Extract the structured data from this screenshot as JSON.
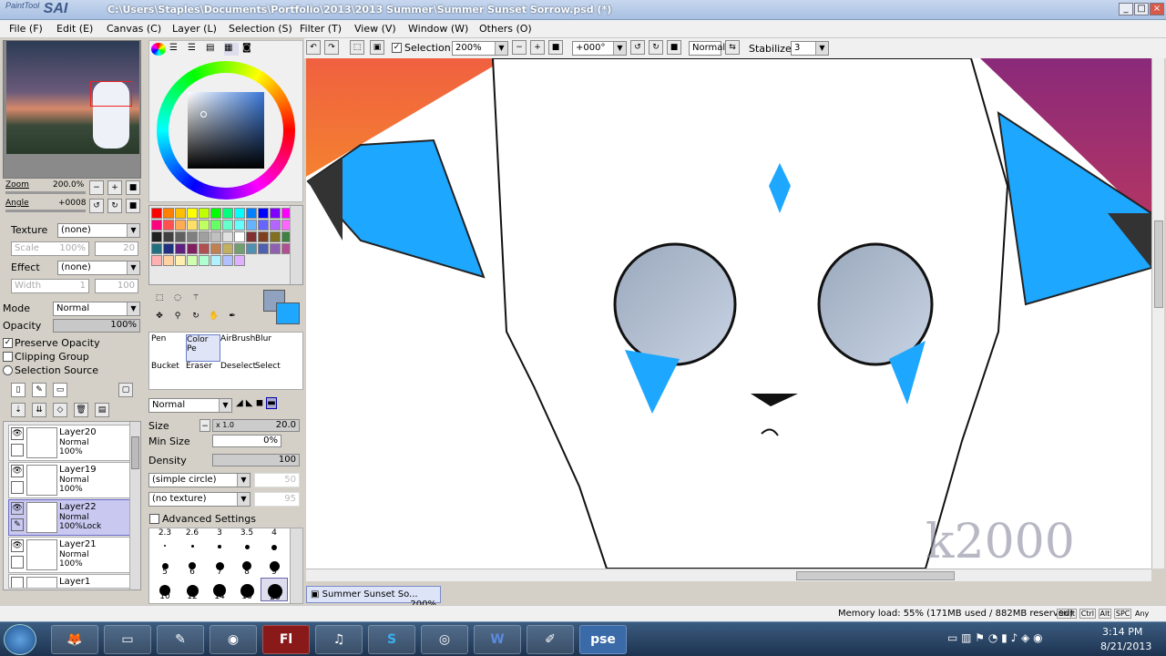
{
  "app": {
    "logo": "SAI",
    "logo_sub": "PaintTool",
    "title": "C:\\Users\\Staples\\Documents\\Portfolio\\2013\\2013 Summer\\Summer Sunset Sorrow.psd (*)"
  },
  "menu": [
    "File (F)",
    "Edit (E)",
    "Canvas (C)",
    "Layer (L)",
    "Selection (S)",
    "Filter (T)",
    "View (V)",
    "Window (W)",
    "Others (O)"
  ],
  "toolbar": {
    "selection_label": "Selection",
    "zoom": "200%",
    "angle": "+000°",
    "blend": "Normal",
    "stabilizer_label": "Stabilizer",
    "stabilizer": "3"
  },
  "navigator": {
    "zoom_label": "Zoom",
    "zoom_value": "200.0%",
    "angle_label": "Angle",
    "angle_value": "+0008"
  },
  "texture": {
    "label": "Texture",
    "value": "(none)",
    "scale_label": "Scale",
    "scale_value": "100%",
    "scale_num": "20"
  },
  "effect": {
    "label": "Effect",
    "value": "(none)",
    "width_label": "Width",
    "width_value": "1",
    "width_num": "100"
  },
  "layer_props": {
    "mode_label": "Mode",
    "mode": "Normal",
    "opacity_label": "Opacity",
    "opacity": "100%",
    "preserve": "Preserve Opacity",
    "clipping": "Clipping Group",
    "selsource": "Selection Source"
  },
  "layers": [
    {
      "name": "Layer20",
      "mode": "Normal",
      "opacity": "100%",
      "selected": false
    },
    {
      "name": "Layer19",
      "mode": "Normal",
      "opacity": "100%",
      "selected": false
    },
    {
      "name": "Layer22",
      "mode": "Normal",
      "opacity": "100%Lock",
      "selected": true
    },
    {
      "name": "Layer21",
      "mode": "Normal",
      "opacity": "100%",
      "selected": false
    },
    {
      "name": "Layer1",
      "mode": "",
      "opacity": "",
      "selected": false
    }
  ],
  "tools": [
    {
      "label": "Pen",
      "selected": false
    },
    {
      "label": "Color Pe",
      "selected": true
    },
    {
      "label": "AirBrush",
      "selected": false
    },
    {
      "label": "Blur",
      "selected": false
    },
    {
      "label": "Bucket",
      "selected": false
    },
    {
      "label": "Eraser",
      "selected": false
    },
    {
      "label": "Deselect",
      "selected": false
    },
    {
      "label": "Select",
      "selected": false
    }
  ],
  "brush": {
    "blend": "Normal",
    "size_label": "Size",
    "size_mult": "x 1.0",
    "size": "20.0",
    "minsize_label": "Min Size",
    "minsize": "0%",
    "density_label": "Density",
    "density": "100",
    "shape": "(simple circle)",
    "shape_num": "50",
    "texture": "(no texture)",
    "texture_num": "95",
    "advanced": "Advanced Settings"
  },
  "brush_sizes": [
    "2.3",
    "2.6",
    "3",
    "3.5",
    "4",
    "5",
    "6",
    "7",
    "8",
    "9",
    "10",
    "12",
    "14",
    "16",
    "20"
  ],
  "colors": {
    "primary": "#8fa3c0",
    "secondary": "#1ea7ff"
  },
  "palette": [
    "#ff0000",
    "#ff7f00",
    "#ffbf00",
    "#ffff00",
    "#bfff00",
    "#00ff00",
    "#00ff7f",
    "#00ffff",
    "#007fff",
    "#0000ff",
    "#7f00ff",
    "#ff00ff",
    "#ff007f",
    "#ff5050",
    "#ffaa55",
    "#ffe066",
    "#c0ff60",
    "#66ff66",
    "#66ffcc",
    "#66ffff",
    "#66b3ff",
    "#6666ff",
    "#b366ff",
    "#ff66ff",
    "#202020",
    "#404040",
    "#606060",
    "#808080",
    "#a0a0a0",
    "#c0c0c0",
    "#e0e0e0",
    "#ffffff",
    "#803030",
    "#804020",
    "#807020",
    "#408040",
    "#207080",
    "#203080",
    "#602080",
    "#802060",
    "#b05050",
    "#c08050",
    "#c0b060",
    "#70a070",
    "#5090b0",
    "#5060b0",
    "#9060b0",
    "#b05090",
    "#ffb0b0",
    "#ffd0a0",
    "#fff0b0",
    "#d0ffb0",
    "#b0ffd0",
    "#b0f0ff",
    "#b0c0ff",
    "#e0b0ff"
  ],
  "doc_tab": {
    "name": "Summer Sunset So...",
    "zoom": "200%"
  },
  "status": {
    "memory": "Memory load: 55% (171MB used / 882MB reserved)",
    "keys": [
      "Shift",
      "Ctrl",
      "Alt",
      "SPC"
    ],
    "any": "Any"
  },
  "watermark": "k2000",
  "clock": {
    "time": "3:14 PM",
    "date": "8/21/2013"
  },
  "taskbar": [
    "start",
    "firefox",
    "explorer",
    "tool",
    "chrome",
    "flash",
    "itunes",
    "skype",
    "app",
    "word",
    "sai",
    "pse"
  ]
}
